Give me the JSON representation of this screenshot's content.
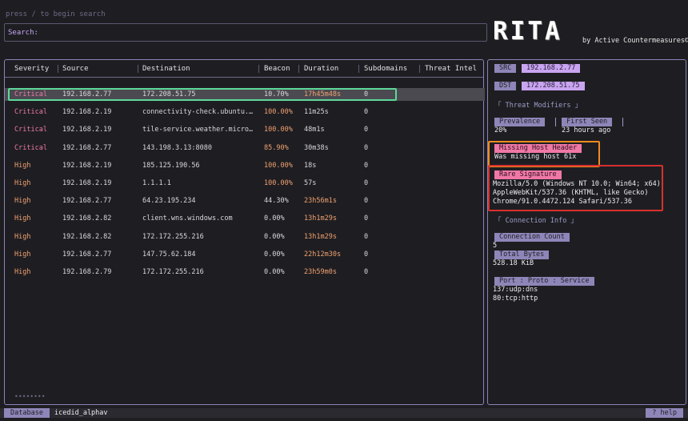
{
  "hint": "press / to begin search",
  "search": {
    "label": "Search:",
    "value": ""
  },
  "logo": {
    "word": "RITA",
    "byline": "by Active Countermeasures©"
  },
  "table": {
    "columns": [
      "Severity",
      "Source",
      "Destination",
      "Beacon",
      "Duration",
      "Subdomains",
      "Threat Intel"
    ],
    "rows": [
      {
        "severity": "Critical",
        "source": "192.168.2.77",
        "destination": "172.208.51.75",
        "beacon": "10.70%",
        "duration": "17h45m48s",
        "subdomains": "0",
        "selected": true
      },
      {
        "severity": "Critical",
        "source": "192.168.2.19",
        "destination": "connectivity-check.ubuntu.…",
        "beacon": "100.00%",
        "duration": "11m25s",
        "subdomains": "0"
      },
      {
        "severity": "Critical",
        "source": "192.168.2.19",
        "destination": "tile-service.weather.micro…",
        "beacon": "100.00%",
        "duration": "48m1s",
        "subdomains": "0"
      },
      {
        "severity": "Critical",
        "source": "192.168.2.77",
        "destination": "143.198.3.13:8080",
        "beacon": "85.90%",
        "duration": "30m38s",
        "subdomains": "0"
      },
      {
        "severity": "High",
        "source": "192.168.2.19",
        "destination": "185.125.190.56",
        "beacon": "100.00%",
        "duration": "18s",
        "subdomains": "0"
      },
      {
        "severity": "High",
        "source": "192.168.2.19",
        "destination": "1.1.1.1",
        "beacon": "100.00%",
        "duration": "57s",
        "subdomains": "0"
      },
      {
        "severity": "High",
        "source": "192.168.2.77",
        "destination": "64.23.195.234",
        "beacon": "44.30%",
        "duration": "23h56m1s",
        "subdomains": "0"
      },
      {
        "severity": "High",
        "source": "192.168.2.82",
        "destination": "client.wns.windows.com",
        "beacon": "0.00%",
        "duration": "13h1m29s",
        "subdomains": "0"
      },
      {
        "severity": "High",
        "source": "192.168.2.82",
        "destination": "172.172.255.216",
        "beacon": "0.00%",
        "duration": "13h1m29s",
        "subdomains": "0"
      },
      {
        "severity": "High",
        "source": "192.168.2.77",
        "destination": "147.75.62.184",
        "beacon": "0.00%",
        "duration": "22h12m30s",
        "subdomains": "0"
      },
      {
        "severity": "High",
        "source": "192.168.2.79",
        "destination": "172.172.255.216",
        "beacon": "0.00%",
        "duration": "23h59m0s",
        "subdomains": "0"
      }
    ],
    "pager": "••••••••"
  },
  "detail": {
    "src_label": "SRC",
    "src_value": "192.168.2.77",
    "dst_label": "DST",
    "dst_value": "172.208.51.75",
    "threat_modifiers": "「 Threat Modifiers 」",
    "prevalence_label": "Prevalence",
    "prevalence_value": "20%",
    "first_seen_label": "First Seen",
    "first_seen_value": "23 hours ago",
    "missing_host_label": "Missing Host Header",
    "missing_host_value": "Was missing host 61x",
    "rare_sig_label": "Rare Signature",
    "rare_sig_lines": [
      "Mozilla/5.0 (Windows NT 10.0; Win64; x64)",
      "AppleWebKit/537.36 (KHTML, like Gecko)",
      "Chrome/91.0.4472.124 Safari/537.36"
    ],
    "connection_info": "「 Connection Info 」",
    "conn_count_label": "Connection Count",
    "conn_count_value": "5",
    "total_bytes_label": "Total Bytes",
    "total_bytes_value": "528.18 KiB",
    "port_label": "Port : Proto : Service",
    "ports": [
      "137:udp:dns",
      "80:tcp:http"
    ]
  },
  "status": {
    "db_label": "Database",
    "db_name": "icedid_alphav",
    "help": "? help"
  },
  "colors": {
    "critical": "#f07aa8",
    "high": "#f0a070",
    "accent": "#8e86b8",
    "value_tag": "#c9a4f0",
    "highlight_green": "#5ed89a",
    "highlight_orange": "#f08a20",
    "highlight_red": "#d83030"
  }
}
